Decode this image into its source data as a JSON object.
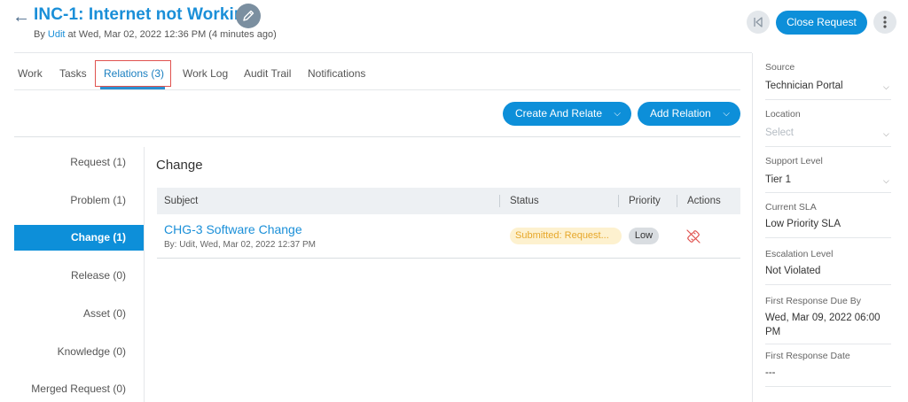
{
  "header": {
    "title": "INC-1: Internet not Working",
    "subtitle_prefix": "By",
    "subtitle_user": "Udit",
    "subtitle_suffix": "at Wed, Mar 02, 2022 12:36 PM (4 minutes ago)",
    "close_request_label": "Close Request"
  },
  "tabs": [
    "Work",
    "Tasks",
    "Relations (3)",
    "Work Log",
    "Audit Trail",
    "Notifications"
  ],
  "actions": {
    "create_and_relate": "Create And Relate",
    "add_relation": "Add Relation"
  },
  "relations_nav": [
    "Request (1)",
    "Problem (1)",
    "Change (1)",
    "Release (0)",
    "Asset (0)",
    "Knowledge (0)",
    "Merged Request (0)"
  ],
  "section_title": "Change",
  "table": {
    "headers": [
      "Subject",
      "Status",
      "Priority",
      "Actions"
    ],
    "row": {
      "subject": "CHG-3 Software Change",
      "meta": "By: Udit, Wed, Mar 02, 2022 12:37 PM",
      "status": "Submitted: Request...",
      "priority": "Low"
    }
  },
  "right_panel": {
    "source_label": "Source",
    "source_value": "Technician Portal",
    "location_label": "Location",
    "location_placeholder": "Select",
    "support_level_label": "Support Level",
    "support_level_value": "Tier 1",
    "current_sla_label": "Current SLA",
    "current_sla_value": "Low Priority SLA",
    "escalation_label": "Escalation Level",
    "escalation_value": "Not Violated",
    "first_response_due_label": "First Response Due By",
    "first_response_due_line1": "Wed, Mar 09, 2022 06:00",
    "first_response_due_line2": "PM",
    "first_response_date_label": "First Response Date",
    "first_response_date_value": "---"
  },
  "colors": {
    "primary": "#0d8fd9",
    "link": "#1a8fd8",
    "status_bg": "#fdf1cf",
    "status_text": "#e6a72a",
    "unlink_icon": "#e0524f"
  },
  "icons": {
    "back": "arrow-left-icon",
    "edit": "pencil-icon",
    "skip": "skip-back-icon",
    "more": "more-vertical-icon",
    "unlink": "unlink-icon"
  }
}
